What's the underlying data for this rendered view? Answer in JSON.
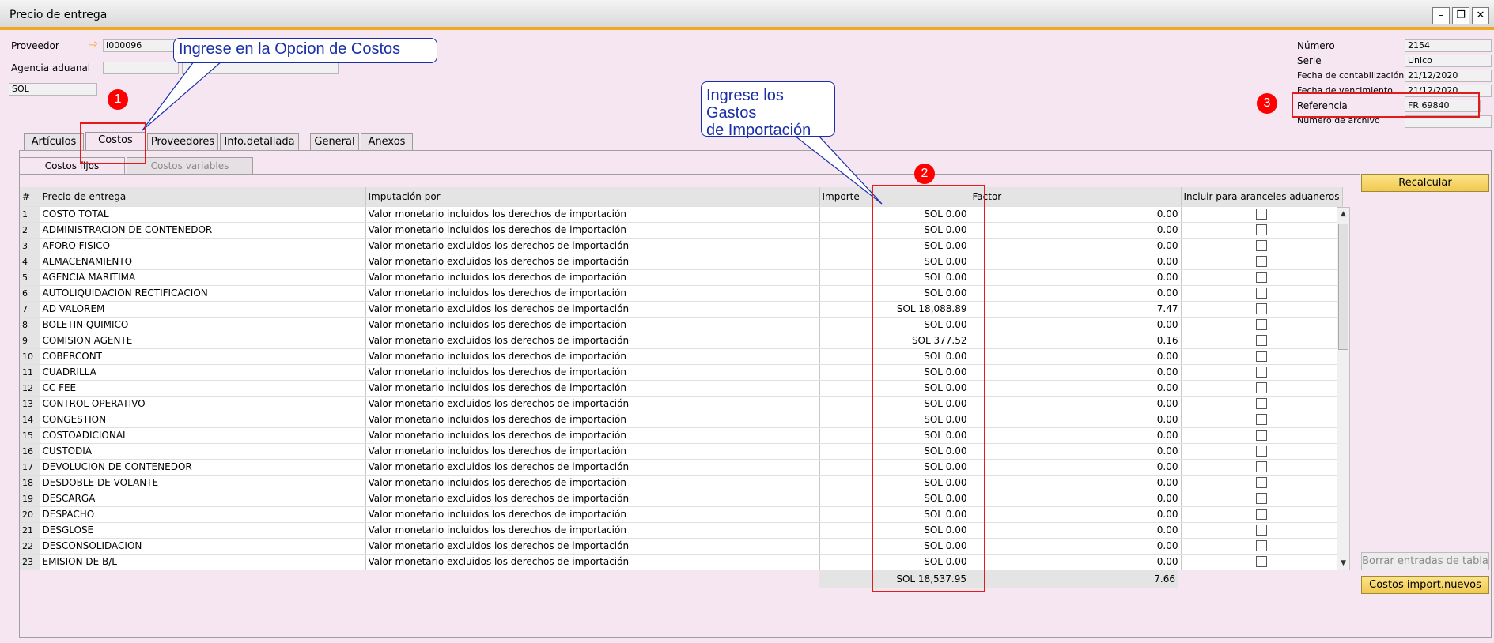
{
  "window": {
    "title": "Precio de entrega"
  },
  "header": {
    "proveedor_label": "Proveedor",
    "proveedor_value": "I000096",
    "agencia_label": "Agencia aduanal",
    "currency": "SOL",
    "numero_label": "Número",
    "numero_value": "2154",
    "serie_label": "Serie",
    "serie_value": "Unico",
    "fecha_cont_label": "Fecha de contabilización",
    "fecha_cont_value": "21/12/2020",
    "fecha_venc_label": "Fecha de vencimiento",
    "fecha_venc_value": "21/12/2020",
    "referencia_label": "Referencia",
    "referencia_value": "FR 69840",
    "archivo_label": "Número de archivo"
  },
  "tabs": [
    "Artículos",
    "Costos",
    "Proveedores",
    "Info.detallada",
    "General",
    "Anexos"
  ],
  "subtabs": [
    "Costos fijos",
    "Costos variables"
  ],
  "table": {
    "columns": [
      "#",
      "Precio de entrega",
      "Imputación por",
      "Importe",
      "Factor",
      "Incluir para aranceles aduaneros"
    ],
    "rows": [
      [
        "1",
        "COSTO TOTAL",
        "Valor monetario incluidos los derechos de importación",
        "SOL 0.00",
        "0.00"
      ],
      [
        "2",
        "ADMINISTRACION  DE CONTENEDOR",
        "Valor monetario incluidos los derechos de importación",
        "SOL 0.00",
        "0.00"
      ],
      [
        "3",
        "AFORO FISICO",
        "Valor monetario excluidos los derechos de importación",
        "SOL 0.00",
        "0.00"
      ],
      [
        "4",
        "ALMACENAMIENTO",
        "Valor monetario excluidos los derechos de importación",
        "SOL 0.00",
        "0.00"
      ],
      [
        "5",
        "AGENCIA MARITIMA",
        "Valor monetario incluidos los derechos de importación",
        "SOL 0.00",
        "0.00"
      ],
      [
        "6",
        "AUTOLIQUIDACION RECTIFICACION",
        "Valor monetario incluidos los derechos de importación",
        "SOL 0.00",
        "0.00"
      ],
      [
        "7",
        "AD VALOREM",
        "Valor monetario excluidos los derechos de importación",
        "SOL 18,088.89",
        "7.47"
      ],
      [
        "8",
        "BOLETIN QUIMICO",
        "Valor monetario incluidos los derechos de importación",
        "SOL 0.00",
        "0.00"
      ],
      [
        "9",
        "COMISION AGENTE",
        "Valor monetario excluidos los derechos de importación",
        "SOL 377.52",
        "0.16"
      ],
      [
        "10",
        "COBERCONT",
        "Valor monetario incluidos los derechos de importación",
        "SOL 0.00",
        "0.00"
      ],
      [
        "11",
        "CUADRILLA",
        "Valor monetario incluidos los derechos de importación",
        "SOL 0.00",
        "0.00"
      ],
      [
        "12",
        "CC FEE",
        "Valor monetario incluidos los derechos de importación",
        "SOL 0.00",
        "0.00"
      ],
      [
        "13",
        "CONTROL OPERATIVO",
        "Valor monetario excluidos los derechos de importación",
        "SOL 0.00",
        "0.00"
      ],
      [
        "14",
        "CONGESTION",
        "Valor monetario incluidos los derechos de importación",
        "SOL 0.00",
        "0.00"
      ],
      [
        "15",
        "COSTOADICIONAL",
        "Valor monetario incluidos los derechos de importación",
        "SOL 0.00",
        "0.00"
      ],
      [
        "16",
        "CUSTODIA",
        "Valor monetario incluidos los derechos de importación",
        "SOL 0.00",
        "0.00"
      ],
      [
        "17",
        "DEVOLUCION DE CONTENEDOR",
        "Valor monetario excluidos los derechos de importación",
        "SOL 0.00",
        "0.00"
      ],
      [
        "18",
        "DESDOBLE DE VOLANTE",
        "Valor monetario incluidos los derechos de importación",
        "SOL 0.00",
        "0.00"
      ],
      [
        "19",
        "DESCARGA",
        "Valor monetario excluidos los derechos de importación",
        "SOL 0.00",
        "0.00"
      ],
      [
        "20",
        "DESPACHO",
        "Valor monetario incluidos los derechos de importación",
        "SOL 0.00",
        "0.00"
      ],
      [
        "21",
        "DESGLOSE",
        "Valor monetario incluidos los derechos de importación",
        "SOL 0.00",
        "0.00"
      ],
      [
        "22",
        "DESCONSOLIDACION",
        "Valor monetario excluidos los derechos de importación",
        "SOL 0.00",
        "0.00"
      ],
      [
        "23",
        "EMISION DE B/L",
        "Valor monetario excluidos los derechos de importación",
        "SOL 0.00",
        "0.00"
      ]
    ],
    "total_importe": "SOL 18,537.95",
    "total_factor": "7.66"
  },
  "buttons": {
    "recalcular": "Recalcular",
    "borrar": "Borrar entradas de tabla",
    "costos_import": "Costos import.nuevos"
  },
  "annotations": {
    "callout1": "Ingrese en la Opcion de Costos",
    "callout2_line1": "Ingrese los Gastos",
    "callout2_line2": "de Importación",
    "badge1": "1",
    "badge2": "2",
    "badge3": "3"
  },
  "colors": {
    "accent": "#f0a81e",
    "annotation": "#1a2ea8",
    "marker": "#e31b1b"
  }
}
